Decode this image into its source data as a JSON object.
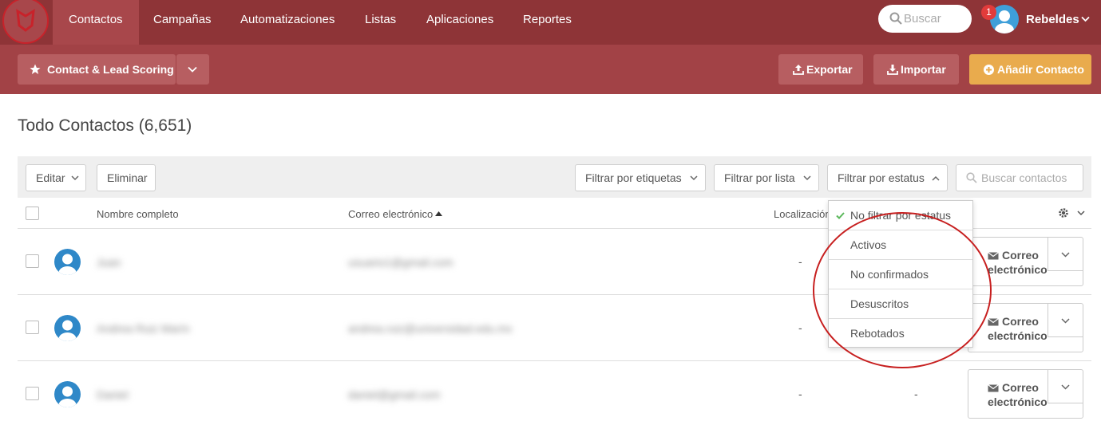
{
  "nav": {
    "items": [
      "Contactos",
      "Campañas",
      "Automatizaciones",
      "Listas",
      "Aplicaciones",
      "Reportes"
    ],
    "search_placeholder": "Buscar",
    "notification_count": "1",
    "user_name": "Rebeldes"
  },
  "subbar": {
    "scoring_label": "Contact & Lead Scoring",
    "export_label": "Exportar",
    "import_label": "Importar",
    "add_label": "Añadir Contacto"
  },
  "page": {
    "title": "Todo Contactos (6,651)"
  },
  "toolbar": {
    "edit_label": "Editar",
    "delete_label": "Eliminar",
    "filter_tags": "Filtrar por etiquetas",
    "filter_list": "Filtrar por lista",
    "filter_status": "Filtrar por estatus",
    "search_placeholder": "Buscar contactos"
  },
  "table": {
    "headers": {
      "name": "Nombre completo",
      "email": "Correo electrónico",
      "location": "Localización"
    },
    "rows": [
      {
        "name": "Juan",
        "email": "usuario1@gmail.com",
        "location": "-",
        "extra": "",
        "action": "Correo electrónico"
      },
      {
        "name": "Andrea Ruiz Marín",
        "email": "andrea.ruiz@universidad.edu.mx",
        "location": "-",
        "extra": "",
        "action": "Correo electrónico"
      },
      {
        "name": "Daniel",
        "email": "daniel@gmail.com",
        "location": "-",
        "extra": "-",
        "action": "Correo electrónico"
      }
    ]
  },
  "status_dropdown": {
    "items": [
      "No filtrar por estatus",
      "Activos",
      "No confirmados",
      "Desuscritos",
      "Rebotados"
    ],
    "selected": "No filtrar por estatus"
  },
  "colors": {
    "nav_bg": "#8e3437",
    "subbar_bg": "#a24246",
    "add_button": "#e9ab4d",
    "annotation_circle": "#c71f1f"
  }
}
